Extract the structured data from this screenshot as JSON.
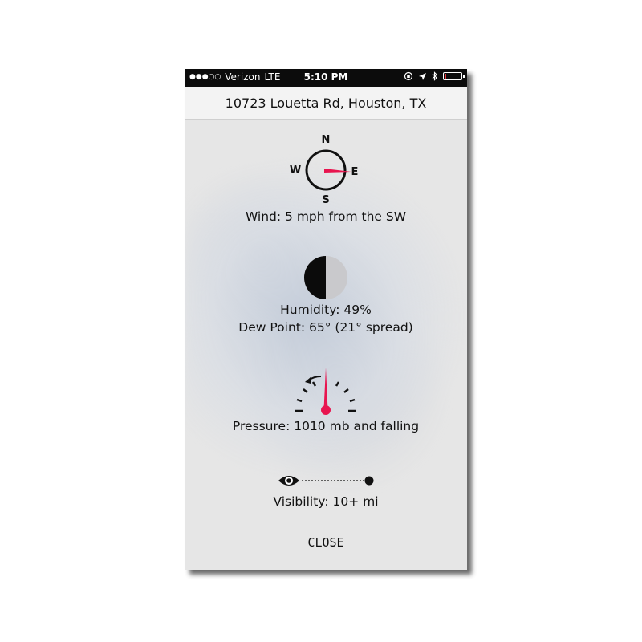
{
  "status": {
    "signal_dots": "●●●○○",
    "carrier": "Verizon",
    "network": "LTE",
    "time": "5:10 PM",
    "battery_level": 0.12,
    "battery_color": "#e8343a"
  },
  "header": {
    "title": "10723 Louetta Rd, Houston, TX"
  },
  "compass": {
    "n": "N",
    "s": "S",
    "e": "E",
    "w": "W"
  },
  "wind": {
    "text": "Wind: 5 mph from the SW"
  },
  "humidity": {
    "text": "Humidity: 49%",
    "level": 0.49
  },
  "dewpoint": {
    "text": "Dew Point: 65° (21° spread)"
  },
  "pressure": {
    "text": "Pressure: 1010 mb and falling"
  },
  "visibility": {
    "text": "Visibility: 10+ mi"
  },
  "actions": {
    "close_label": "CLOSE"
  },
  "colors": {
    "accent": "#e8154f"
  }
}
